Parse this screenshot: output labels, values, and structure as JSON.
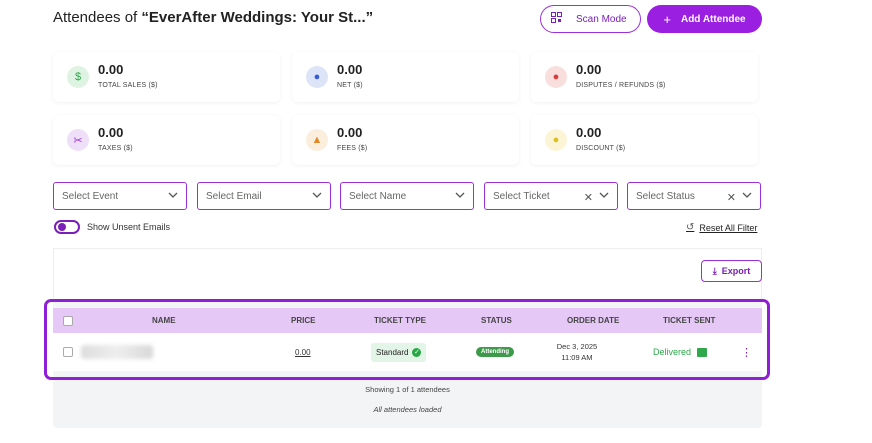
{
  "header": {
    "title_prefix": "Attendees of ",
    "title_event": "“EverAfter Weddings: Your St...”",
    "scan_label": "Scan Mode",
    "add_label": "Add Attendee"
  },
  "stats": [
    {
      "value": "0.00",
      "label": "TOTAL SALES ($)",
      "icon": "dollar-icon",
      "color": "#2ea84a"
    },
    {
      "value": "0.00",
      "label": "NET ($)",
      "icon": "money-bag-icon",
      "color": "#3a5bd9"
    },
    {
      "value": "0.00",
      "label": "DISPUTES / REFUNDS ($)",
      "icon": "refund-icon",
      "color": "#d93a3a"
    },
    {
      "value": "0.00",
      "label": "TAXES ($)",
      "icon": "scissors-icon",
      "color": "#9b30d9"
    },
    {
      "value": "0.00",
      "label": "FEES ($)",
      "icon": "fee-icon",
      "color": "#e08a2a"
    },
    {
      "value": "0.00",
      "label": "DISCOUNT ($)",
      "icon": "coin-icon",
      "color": "#e0c020"
    }
  ],
  "filters": {
    "event": "Select Event",
    "email": "Select Email",
    "name": "Select Name",
    "ticket": "Select Ticket",
    "status": "Select Status"
  },
  "toggle_label": "Show Unsent Emails",
  "reset_label": "Reset All Filter",
  "export_label": "Export",
  "table": {
    "columns": [
      "NAME",
      "PRICE",
      "TICKET TYPE",
      "STATUS",
      "ORDER DATE",
      "TICKET SENT"
    ],
    "rows": [
      {
        "price": "0.00",
        "ticket_type": "Standard",
        "status": "Attending",
        "date_line1": "Dec 3, 2025",
        "date_line2": "11:09 AM",
        "sent": "Delivered"
      }
    ]
  },
  "footer": {
    "showing": "Showing 1 of 1 attendees",
    "loaded": "All attendees loaded"
  },
  "accent": "#9b1fe0"
}
